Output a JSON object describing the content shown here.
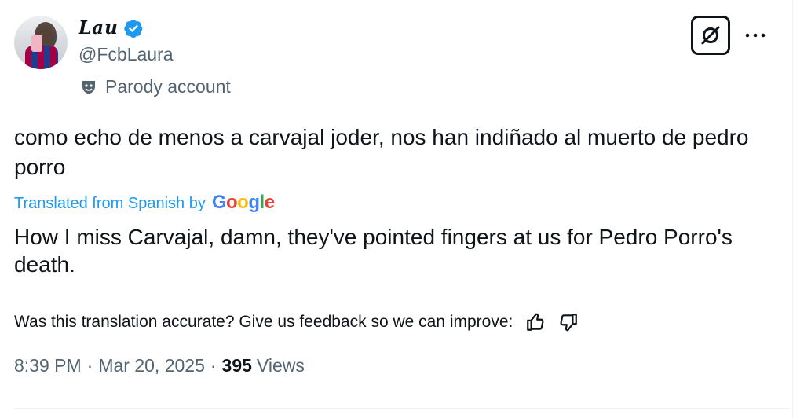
{
  "author": {
    "display_name": "Lau",
    "handle": "@FcbLaura",
    "verified": true,
    "label": "Parody account",
    "avatar_icon": "user-avatar"
  },
  "header": {
    "grok_icon": "grok-icon",
    "more_icon": "more-icon"
  },
  "tweet": {
    "text": "como echo de menos a carvajal joder, nos han indiñado al muerto de pedro porro"
  },
  "translation": {
    "label": "Translated from Spanish by",
    "provider": "Google",
    "text": "How I miss Carvajal, damn, they've pointed fingers at us for Pedro Porro's death.",
    "feedback_prompt": "Was this translation accurate? Give us feedback so we can improve:"
  },
  "meta": {
    "time": "8:39 PM",
    "separator": "·",
    "date": "Mar 20, 2025",
    "views_count": "395",
    "views_label": "Views"
  },
  "colors": {
    "link": "#1d9bf0",
    "secondary_text": "#536471",
    "verified_badge": "#1d9bf0"
  }
}
